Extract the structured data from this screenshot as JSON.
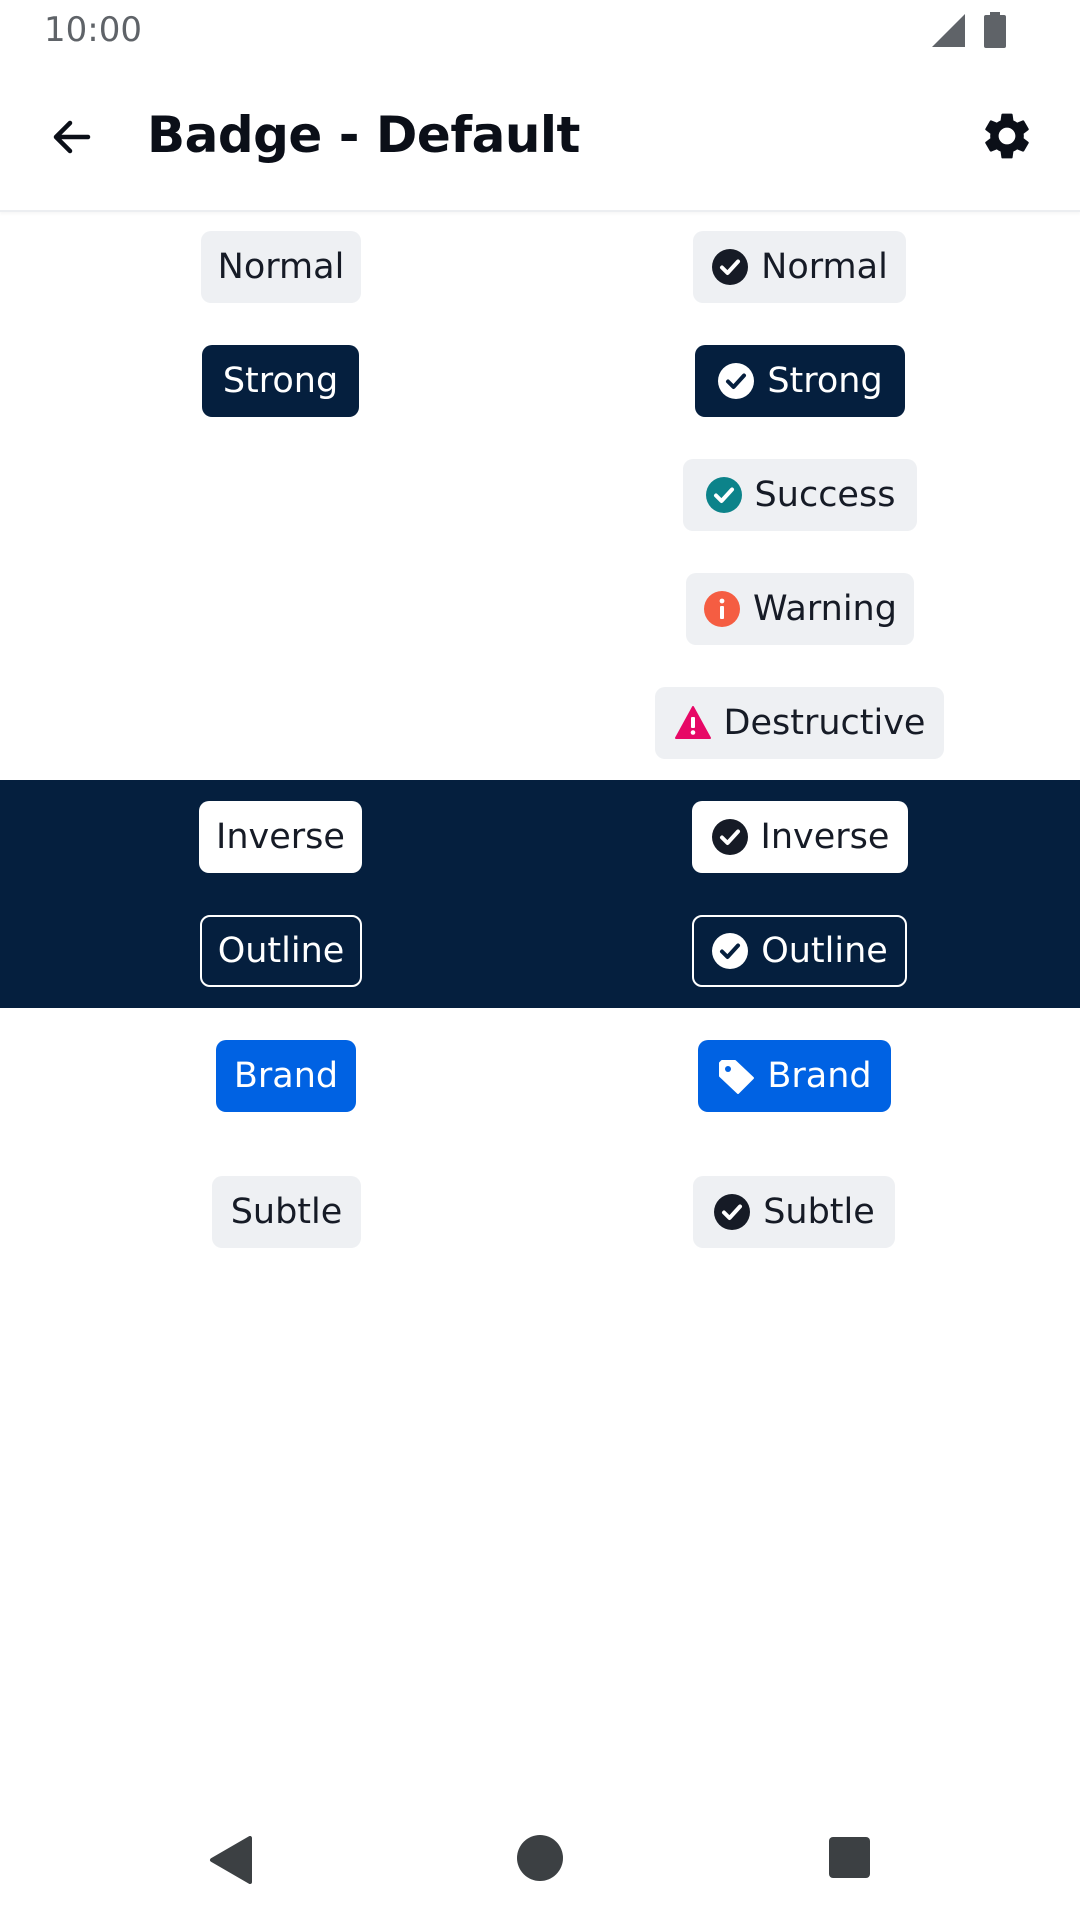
{
  "status_bar": {
    "time": "10:00",
    "signal_icon": "cellular-signal-icon",
    "battery_icon": "battery-full-icon"
  },
  "app_bar": {
    "title": "Badge - Default",
    "back_icon": "arrow-left-icon",
    "settings_icon": "gear-icon"
  },
  "colors": {
    "strong_bg": "#051f3e",
    "neutral_bg": "#eef0f3",
    "brand": "#0062e3",
    "success": "#0c838a",
    "warning": "#f55d42",
    "destructive": "#e70866",
    "text": "#161b26"
  },
  "badges": {
    "left": {
      "normal": "Normal",
      "strong": "Strong",
      "inverse": "Inverse",
      "outline": "Outline",
      "brand": "Brand",
      "subtle": "Subtle"
    },
    "right": {
      "normal": "Normal",
      "strong": "Strong",
      "success": "Success",
      "warning": "Warning",
      "destructive": "Destructive",
      "inverse": "Inverse",
      "outline": "Outline",
      "brand": "Brand",
      "subtle": "Subtle"
    },
    "icons": {
      "normal": "tick-circle-icon",
      "strong": "tick-circle-icon",
      "success": "tick-circle-icon",
      "warning": "info-circle-icon",
      "destructive": "warning-triangle-icon",
      "inverse": "tick-circle-icon",
      "outline": "tick-circle-icon",
      "brand": "price-tag-icon",
      "subtle": "tick-circle-icon"
    }
  },
  "nav_bar": {
    "back": "nav-back-icon",
    "home": "nav-home-icon",
    "recents": "nav-recents-icon"
  }
}
